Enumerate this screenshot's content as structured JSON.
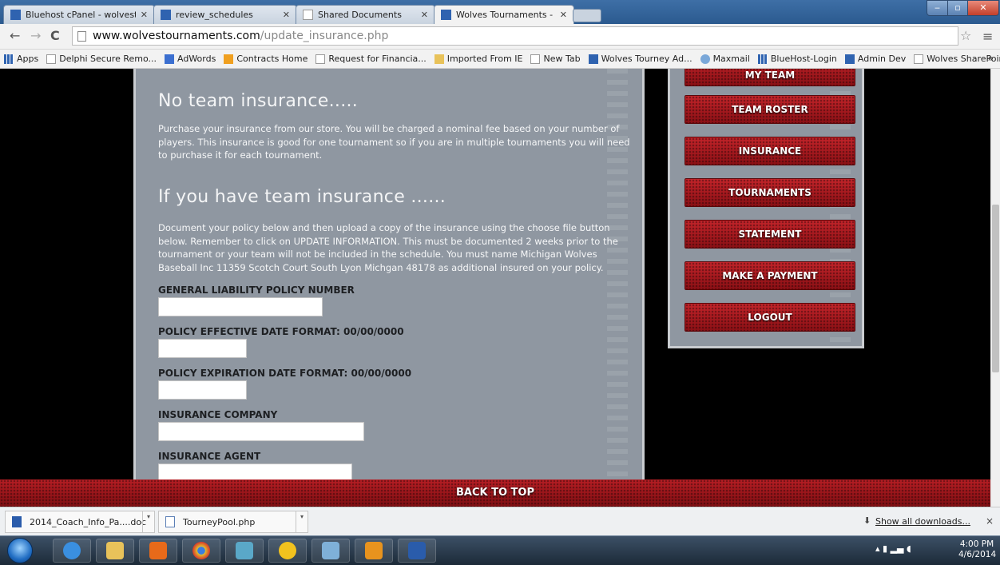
{
  "browser": {
    "tabs": [
      {
        "label": "Bluehost cPanel - wolvest",
        "active": false
      },
      {
        "label": "review_schedules",
        "active": false
      },
      {
        "label": "Shared Documents",
        "active": false
      },
      {
        "label": "Wolves Tournaments - Ins",
        "active": true
      }
    ],
    "url_host": "www.wolvestournaments.com",
    "url_path": "/update_insurance.php",
    "bookmarks": [
      "Apps",
      "Delphi Secure Remo...",
      "AdWords",
      "Contracts Home",
      "Request for Financia...",
      "Imported From IE",
      "New Tab",
      "Wolves Tourney Ad...",
      "Maxmail",
      "BlueHost-Login",
      "Admin Dev",
      "Wolves SharePoint"
    ],
    "bookmarks_more": "»"
  },
  "content": {
    "heading_no_insurance": "No team insurance.....",
    "para_no_insurance": "Purchase your insurance from our store. You will be charged a nominal fee based on your number of players. This insurance is good for one tournament so if you are in multiple tournaments you will need to purchase it for each tournament.",
    "heading_have_insurance": "If you have team insurance ......",
    "para_have_insurance": "Document your policy below and then upload a copy of the insurance using the choose file button below. Remember to click on UPDATE INFORMATION. This must be documented 2 weeks prior to the tournament or your team will not be included in the schedule. You must name Michigan Wolves Baseball Inc 11359 Scotch Court South Lyon Michgan 48178 as additional insured on your policy.",
    "fields": [
      {
        "label": "GENERAL LIABILITY POLICY NUMBER",
        "value": ""
      },
      {
        "label": "POLICY EFFECTIVE DATE FORMAT: 00/00/0000",
        "value": ""
      },
      {
        "label": "POLICY EXPIRATION DATE FORMAT: 00/00/0000",
        "value": ""
      },
      {
        "label": "INSURANCE COMPANY",
        "value": ""
      },
      {
        "label": "INSURANCE AGENT",
        "value": ""
      }
    ]
  },
  "sidebar": {
    "items": [
      "MY TEAM",
      "TEAM ROSTER",
      "INSURANCE",
      "TOURNAMENTS",
      "STATEMENT",
      "MAKE A PAYMENT",
      "LOGOUT"
    ]
  },
  "footer": {
    "back_to_top": "BACK TO TOP"
  },
  "downloads": {
    "items": [
      "2014_Coach_Info_Pa....doc",
      "TourneyPool.php"
    ],
    "show_all": "Show all downloads...",
    "close": "×"
  },
  "taskbar": {
    "time": "4:00 PM",
    "date": "4/6/2014"
  },
  "colors": {
    "panel": "#8f97a1",
    "button_red": "#b81e24",
    "page_bg": "#000000"
  }
}
